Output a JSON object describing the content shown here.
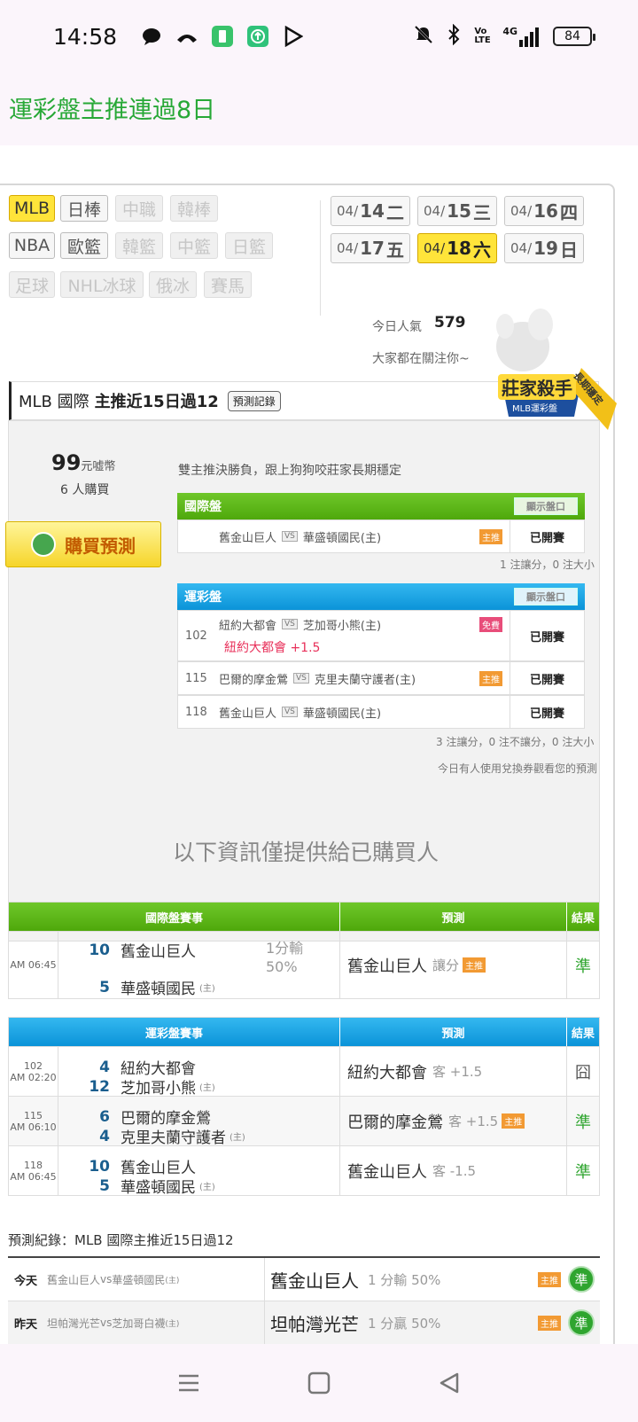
{
  "status": {
    "time": "14:58",
    "net": "4G",
    "volte": "Vo LTE",
    "battery": "84"
  },
  "page_title": "運彩盤主推連過8日",
  "sports": [
    {
      "label": "MLB",
      "state": "on"
    },
    {
      "label": "日棒",
      "state": "normal"
    },
    {
      "label": "中職",
      "state": "dim"
    },
    {
      "label": "韓棒",
      "state": "dim"
    },
    {
      "label": "NBA",
      "state": "normal"
    },
    {
      "label": "歐籃",
      "state": "normal"
    },
    {
      "label": "韓籃",
      "state": "dim"
    },
    {
      "label": "中籃",
      "state": "dim"
    },
    {
      "label": "日籃",
      "state": "dim"
    },
    {
      "label": "足球",
      "state": "dim"
    },
    {
      "label": "NHL冰球",
      "state": "dim"
    },
    {
      "label": "俄冰",
      "state": "dim"
    },
    {
      "label": "賽馬",
      "state": "dim"
    }
  ],
  "dates": [
    {
      "pre": "04/",
      "day": "14",
      "wd": "二"
    },
    {
      "pre": "04/",
      "day": "15",
      "wd": "三"
    },
    {
      "pre": "04/",
      "day": "16",
      "wd": "四"
    },
    {
      "pre": "04/",
      "day": "17",
      "wd": "五"
    },
    {
      "pre": "04/",
      "day": "18",
      "wd": "六",
      "on": true
    },
    {
      "pre": "04/",
      "day": "19",
      "wd": "日"
    }
  ],
  "popularity": {
    "label": "今日人氣",
    "value": "579",
    "sub": "大家都在關注你~"
  },
  "card": {
    "title_a": "MLB 國際",
    "title_b": "主推近15日過12",
    "record_btn": "預測記錄",
    "badge_main": "莊家殺手",
    "badge_sub": "MLB運彩盤",
    "badge_ribbon": "長期穩定",
    "price": "99",
    "price_unit": "元嘘幣",
    "buyers": "6 人購買",
    "buy_btn": "購買預測",
    "desc": "雙主推決勝負，跟上狗狗咬莊家長期穩定",
    "intl_title": "國際盤",
    "show_btn": "顯示盤口",
    "intl_rows": [
      {
        "num": "",
        "away": "舊金山巨人",
        "home": "華盛頓國民(主)",
        "tag": "主推",
        "status": "已開賽"
      }
    ],
    "intl_note": "1 注讓分，0 注大小",
    "sport_title": "運彩盤",
    "sport_rows": [
      {
        "num": "102",
        "away": "紐約大都會",
        "home": "芝加哥小熊(主)",
        "pick": "紐約大都會 +1.5",
        "tag": "免費",
        "status": "已開賽"
      },
      {
        "num": "115",
        "away": "巴爾的摩金鶯",
        "home": "克里夫蘭守護者(主)",
        "tag": "主推",
        "status": "已開賽"
      },
      {
        "num": "118",
        "away": "舊金山巨人",
        "home": "華盛頓國民(主)",
        "tag": "",
        "status": "已開賽"
      }
    ],
    "sport_note": "3 注讓分，0 注不讓分，0 注大小",
    "voucher_note": "今日有人使用兌換券觀看您的預測"
  },
  "notice": "以下資訊僅提供給已購買人",
  "intl_result": {
    "head": [
      "國際盤賽事",
      "預測",
      "結果"
    ],
    "rows": [
      {
        "time": "AM 06:45",
        "away_score": "10",
        "away": "舊金山巨人",
        "home_score": "5",
        "home": "華盛頓國民",
        "home_mark": "(主)",
        "line": "1分輸",
        "pct": "50%",
        "pick": "舊金山巨人",
        "pick_sub": "讓分",
        "tag": "主推",
        "result": "準"
      }
    ]
  },
  "sport_result": {
    "head": [
      "運彩盤賽事",
      "預測",
      "結果"
    ],
    "rows": [
      {
        "num": "102",
        "time": "AM 02:20",
        "away_score": "4",
        "away": "紐約大都會",
        "home_score": "12",
        "home": "芝加哥小熊",
        "home_mark": "(主)",
        "pick": "紐約大都會",
        "pick_sub": "客 +1.5",
        "tag": "",
        "result": "囧"
      },
      {
        "num": "115",
        "time": "AM 06:10",
        "away_score": "6",
        "away": "巴爾的摩金鶯",
        "home_score": "4",
        "home": "克里夫蘭守護者",
        "home_mark": "(主)",
        "pick": "巴爾的摩金鶯",
        "pick_sub": "客 +1.5",
        "tag": "主推",
        "result": "準"
      },
      {
        "num": "118",
        "time": "AM 06:45",
        "away_score": "10",
        "away": "舊金山巨人",
        "home_score": "5",
        "home": "華盛頓國民",
        "home_mark": "(主)",
        "pick": "舊金山巨人",
        "pick_sub": "客 -1.5",
        "tag": "",
        "result": "準"
      }
    ]
  },
  "history": {
    "title": "預測紀錄：MLB 國際主推近15日過12",
    "rows": [
      {
        "day": "今天",
        "away": "舊金山巨人",
        "vs": "vs",
        "home": "華盛頓國民",
        "home_mark": "(主)",
        "pick": "舊金山巨人",
        "line": "1 分輸 50%",
        "tag": "主推",
        "result": "準"
      },
      {
        "day": "昨天",
        "away": "坦帕灣光芒",
        "vs": "vs",
        "home": "芝加哥白襪",
        "home_mark": "(主)",
        "pick": "坦帕灣光芒",
        "line": "1 分贏 50%",
        "tag": "主推",
        "result": "準"
      }
    ]
  },
  "colors": {
    "green": "#27a836",
    "accent_yellow": "#ffe43a",
    "win": "#2fa52f",
    "blue": "#0b93d8"
  }
}
